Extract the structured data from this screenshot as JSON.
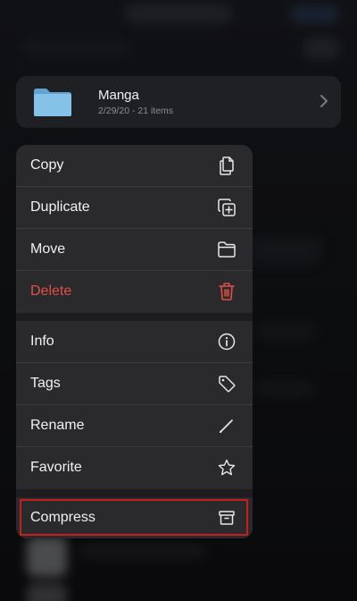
{
  "folder": {
    "name": "Manga",
    "subtitle": "2/29/20 - 21 items",
    "icon": "folder-icon",
    "color": "#7fb8e0"
  },
  "menu": {
    "items": [
      {
        "label": "Copy",
        "icon": "copy-icon"
      },
      {
        "label": "Duplicate",
        "icon": "duplicate-icon"
      },
      {
        "label": "Move",
        "icon": "folder-icon"
      },
      {
        "label": "Delete",
        "icon": "trash-icon",
        "color": "#e0504a"
      },
      {
        "label": "Info",
        "icon": "info-icon"
      },
      {
        "label": "Tags",
        "icon": "tag-icon"
      },
      {
        "label": "Rename",
        "icon": "pencil-icon"
      },
      {
        "label": "Favorite",
        "icon": "star-icon"
      },
      {
        "label": "Compress",
        "icon": "archive-icon",
        "highlighted": true,
        "highlight_color": "#c91d1d"
      }
    ]
  }
}
